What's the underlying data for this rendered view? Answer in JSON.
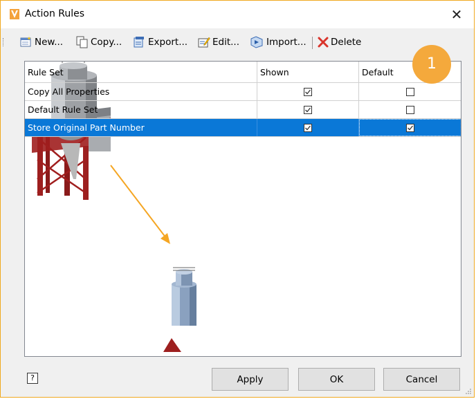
{
  "window": {
    "title": "Action Rules"
  },
  "toolbar": {
    "new_label": "New...",
    "copy_label": "Copy...",
    "export_label": "Export...",
    "edit_label": "Edit...",
    "import_label": "Import...",
    "delete_label": "Delete"
  },
  "grid": {
    "headers": {
      "rule_set": "Rule Set",
      "shown": "Shown",
      "default": "Default"
    },
    "rows": [
      {
        "name": "Copy All Properties",
        "shown": true,
        "default": false
      },
      {
        "name": "Default Rule Set",
        "shown": true,
        "default": false
      },
      {
        "name": "Store Original Part Number",
        "shown": true,
        "default": true,
        "selected": true
      }
    ]
  },
  "callout": {
    "number": "1"
  },
  "footer": {
    "help": "?",
    "apply": "Apply",
    "ok": "OK",
    "cancel": "Cancel"
  },
  "colors": {
    "accent": "#0a78d7",
    "callout": "#f4a93c",
    "window_border": "#f0a91f",
    "arrow": "#f5a623",
    "frame_red": "#a01e1e"
  },
  "icons": [
    "vault-app-icon",
    "close-icon",
    "new-icon",
    "copy-icon",
    "export-icon",
    "edit-icon",
    "import-icon",
    "delete-icon",
    "help-icon"
  ]
}
